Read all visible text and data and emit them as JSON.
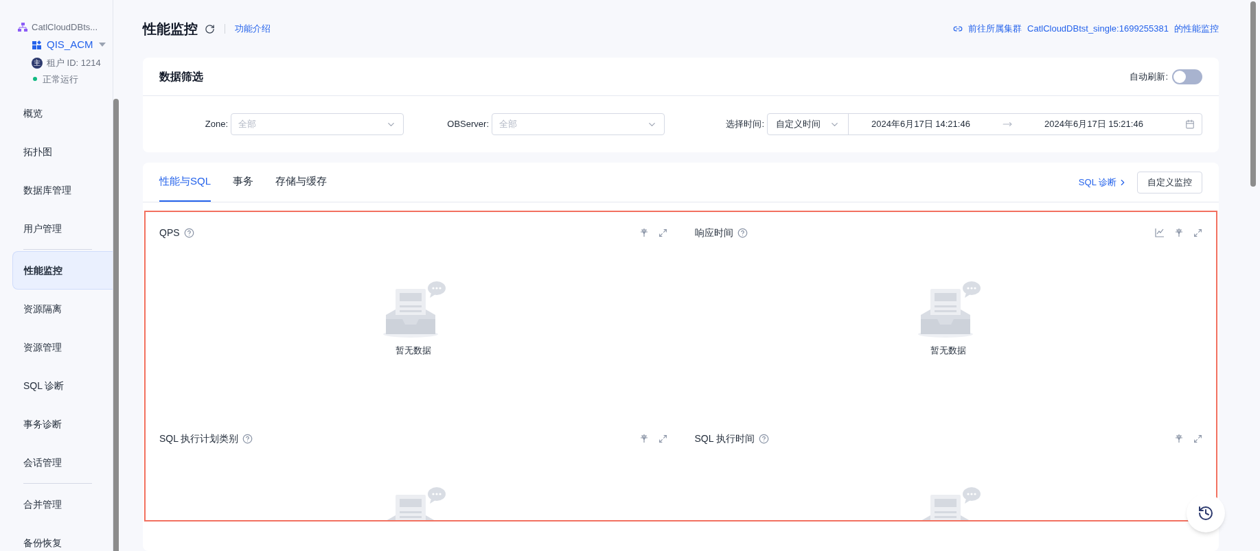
{
  "sidebar": {
    "cluster": "CatlCloudDBts...",
    "tenant": "QIS_ACM",
    "tenant_badge": "主",
    "tenant_id": "租户 ID: 1214",
    "status": "正常运行",
    "groups": [
      [
        {
          "label": "概览",
          "selected": false
        },
        {
          "label": "拓扑图",
          "selected": false
        },
        {
          "label": "数据库管理",
          "selected": false
        },
        {
          "label": "用户管理",
          "selected": false
        }
      ],
      [
        {
          "label": "性能监控",
          "selected": true
        },
        {
          "label": "资源隔离",
          "selected": false
        },
        {
          "label": "资源管理",
          "selected": false
        },
        {
          "label": "SQL 诊断",
          "selected": false
        },
        {
          "label": "事务诊断",
          "selected": false
        },
        {
          "label": "会话管理",
          "selected": false
        }
      ],
      [
        {
          "label": "合并管理",
          "selected": false
        },
        {
          "label": "备份恢复",
          "selected": false
        }
      ]
    ]
  },
  "header": {
    "title": "性能监控",
    "intro_link": "功能介绍",
    "cluster_link": {
      "prefix": "前往所属集群",
      "name": "CatlCloudDBtst_single:1699255381",
      "suffix": "的性能监控"
    }
  },
  "filter": {
    "title": "数据筛选",
    "auto_refresh": {
      "label": "自动刷新:",
      "on": false
    },
    "selects": [
      {
        "label": "Zone:",
        "placeholder": "全部"
      },
      {
        "label": "OBServer:",
        "placeholder": "全部"
      }
    ],
    "time": {
      "label": "选择时间:",
      "mode": "自定义时间",
      "start": "2024年6月17日 14:21:46",
      "end": "2024年6月17日 15:21:46"
    }
  },
  "tabs": [
    {
      "label": "性能与SQL",
      "selected": true
    },
    {
      "label": "事务",
      "selected": false
    },
    {
      "label": "存储与缓存",
      "selected": false
    }
  ],
  "sql_link": "SQL 诊断",
  "custom_button": "自定义监控",
  "panels": [
    {
      "title": "QPS",
      "sql_chart_button": false,
      "empty_text": "暂无数据"
    },
    {
      "title": "响应时间",
      "sql_chart_button": true,
      "empty_text": "暂无数据"
    },
    {
      "title": "SQL 执行计划类别",
      "sql_chart_button": false
    },
    {
      "title": "SQL 执行时间",
      "sql_chart_button": false
    }
  ]
}
